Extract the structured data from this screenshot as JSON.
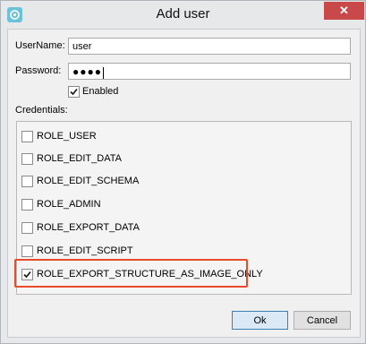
{
  "window": {
    "title": "Add user",
    "app_icon": "app-logo-icon",
    "close_icon": "close-icon"
  },
  "form": {
    "username_label": "UserName:",
    "username_value": "user",
    "password_label": "Password:",
    "password_value": "●●●●",
    "enabled_label": "Enabled",
    "enabled_checked": true,
    "credentials_label": "Credentials:"
  },
  "roles": [
    {
      "label": "ROLE_USER",
      "checked": false
    },
    {
      "label": "ROLE_EDIT_DATA",
      "checked": false
    },
    {
      "label": "ROLE_EDIT_SCHEMA",
      "checked": false
    },
    {
      "label": "ROLE_ADMIN",
      "checked": false
    },
    {
      "label": "ROLE_EXPORT_DATA",
      "checked": false
    },
    {
      "label": "ROLE_EDIT_SCRIPT",
      "checked": false
    },
    {
      "label": "ROLE_EXPORT_STRUCTURE_AS_IMAGE_ONLY",
      "checked": true
    }
  ],
  "buttons": {
    "ok": "Ok",
    "cancel": "Cancel"
  },
  "colors": {
    "highlight": "#e84c2a",
    "close_button": "#c9494b"
  }
}
